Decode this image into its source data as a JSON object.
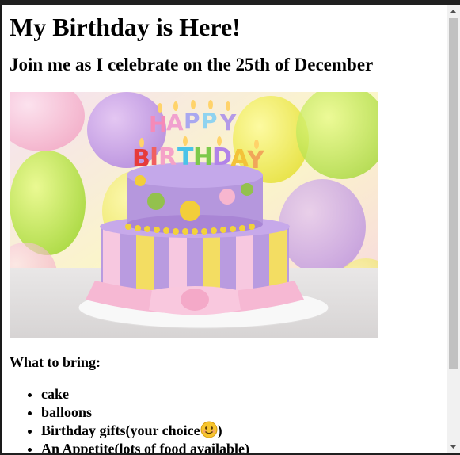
{
  "page": {
    "heading": "My Birthday is Here!",
    "subheading": "Join me as I celebrate on the 25th of December",
    "image": {
      "candle_letters_top": [
        "H",
        "A",
        "P",
        "P",
        "Y"
      ],
      "candle_letters_bottom": [
        "B",
        "I",
        "R",
        "T",
        "H",
        "D",
        "A",
        "Y"
      ]
    },
    "bring_title": "What to bring:",
    "bring_items": [
      {
        "text": "cake"
      },
      {
        "text": "balloons"
      },
      {
        "text": "Birthday gifts(your choice",
        "suffix": ")",
        "emoji": "smiley-emoji"
      },
      {
        "text": "An Appetite(lots of food available)"
      }
    ]
  },
  "colors": {
    "page_bg": "#ffffff",
    "scrollbar_track": "#f1f1f1",
    "scrollbar_thumb": "#c1c1c1"
  }
}
